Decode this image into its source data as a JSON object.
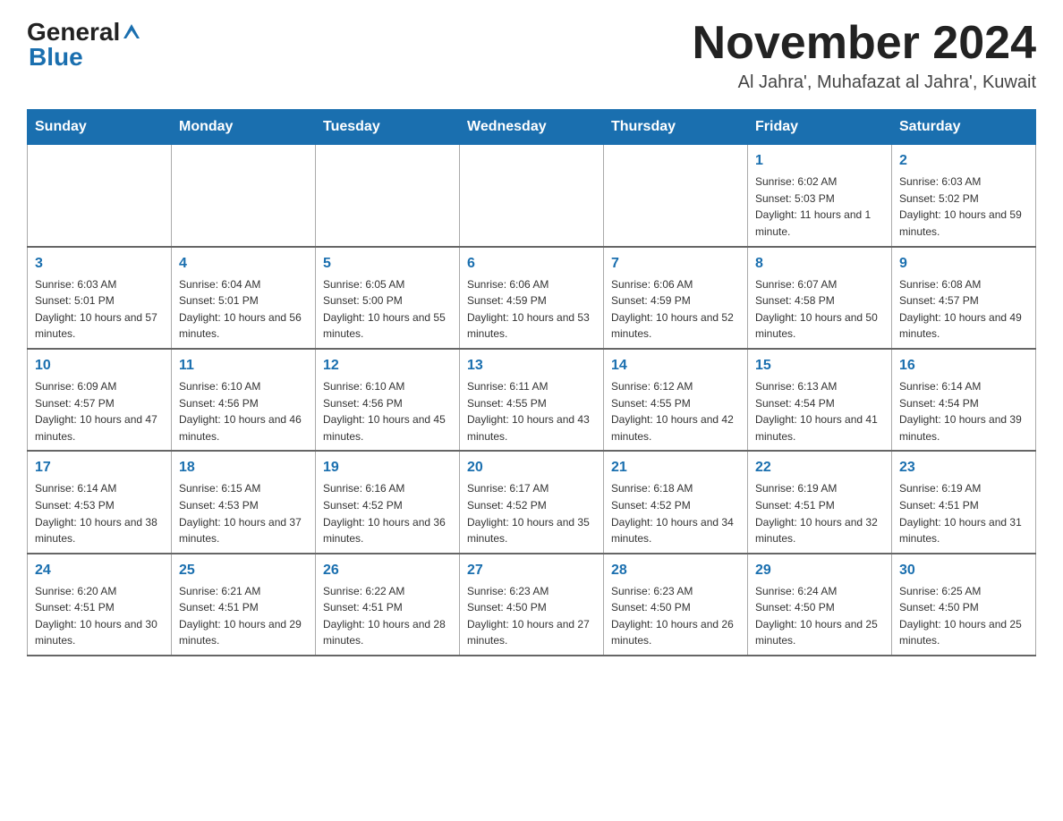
{
  "logo": {
    "general": "General",
    "blue": "Blue"
  },
  "title": "November 2024",
  "subtitle": "Al Jahra', Muhafazat al Jahra', Kuwait",
  "days_of_week": [
    "Sunday",
    "Monday",
    "Tuesday",
    "Wednesday",
    "Thursday",
    "Friday",
    "Saturday"
  ],
  "weeks": [
    [
      {
        "day": "",
        "info": ""
      },
      {
        "day": "",
        "info": ""
      },
      {
        "day": "",
        "info": ""
      },
      {
        "day": "",
        "info": ""
      },
      {
        "day": "",
        "info": ""
      },
      {
        "day": "1",
        "info": "Sunrise: 6:02 AM\nSunset: 5:03 PM\nDaylight: 11 hours and 1 minute."
      },
      {
        "day": "2",
        "info": "Sunrise: 6:03 AM\nSunset: 5:02 PM\nDaylight: 10 hours and 59 minutes."
      }
    ],
    [
      {
        "day": "3",
        "info": "Sunrise: 6:03 AM\nSunset: 5:01 PM\nDaylight: 10 hours and 57 minutes."
      },
      {
        "day": "4",
        "info": "Sunrise: 6:04 AM\nSunset: 5:01 PM\nDaylight: 10 hours and 56 minutes."
      },
      {
        "day": "5",
        "info": "Sunrise: 6:05 AM\nSunset: 5:00 PM\nDaylight: 10 hours and 55 minutes."
      },
      {
        "day": "6",
        "info": "Sunrise: 6:06 AM\nSunset: 4:59 PM\nDaylight: 10 hours and 53 minutes."
      },
      {
        "day": "7",
        "info": "Sunrise: 6:06 AM\nSunset: 4:59 PM\nDaylight: 10 hours and 52 minutes."
      },
      {
        "day": "8",
        "info": "Sunrise: 6:07 AM\nSunset: 4:58 PM\nDaylight: 10 hours and 50 minutes."
      },
      {
        "day": "9",
        "info": "Sunrise: 6:08 AM\nSunset: 4:57 PM\nDaylight: 10 hours and 49 minutes."
      }
    ],
    [
      {
        "day": "10",
        "info": "Sunrise: 6:09 AM\nSunset: 4:57 PM\nDaylight: 10 hours and 47 minutes."
      },
      {
        "day": "11",
        "info": "Sunrise: 6:10 AM\nSunset: 4:56 PM\nDaylight: 10 hours and 46 minutes."
      },
      {
        "day": "12",
        "info": "Sunrise: 6:10 AM\nSunset: 4:56 PM\nDaylight: 10 hours and 45 minutes."
      },
      {
        "day": "13",
        "info": "Sunrise: 6:11 AM\nSunset: 4:55 PM\nDaylight: 10 hours and 43 minutes."
      },
      {
        "day": "14",
        "info": "Sunrise: 6:12 AM\nSunset: 4:55 PM\nDaylight: 10 hours and 42 minutes."
      },
      {
        "day": "15",
        "info": "Sunrise: 6:13 AM\nSunset: 4:54 PM\nDaylight: 10 hours and 41 minutes."
      },
      {
        "day": "16",
        "info": "Sunrise: 6:14 AM\nSunset: 4:54 PM\nDaylight: 10 hours and 39 minutes."
      }
    ],
    [
      {
        "day": "17",
        "info": "Sunrise: 6:14 AM\nSunset: 4:53 PM\nDaylight: 10 hours and 38 minutes."
      },
      {
        "day": "18",
        "info": "Sunrise: 6:15 AM\nSunset: 4:53 PM\nDaylight: 10 hours and 37 minutes."
      },
      {
        "day": "19",
        "info": "Sunrise: 6:16 AM\nSunset: 4:52 PM\nDaylight: 10 hours and 36 minutes."
      },
      {
        "day": "20",
        "info": "Sunrise: 6:17 AM\nSunset: 4:52 PM\nDaylight: 10 hours and 35 minutes."
      },
      {
        "day": "21",
        "info": "Sunrise: 6:18 AM\nSunset: 4:52 PM\nDaylight: 10 hours and 34 minutes."
      },
      {
        "day": "22",
        "info": "Sunrise: 6:19 AM\nSunset: 4:51 PM\nDaylight: 10 hours and 32 minutes."
      },
      {
        "day": "23",
        "info": "Sunrise: 6:19 AM\nSunset: 4:51 PM\nDaylight: 10 hours and 31 minutes."
      }
    ],
    [
      {
        "day": "24",
        "info": "Sunrise: 6:20 AM\nSunset: 4:51 PM\nDaylight: 10 hours and 30 minutes."
      },
      {
        "day": "25",
        "info": "Sunrise: 6:21 AM\nSunset: 4:51 PM\nDaylight: 10 hours and 29 minutes."
      },
      {
        "day": "26",
        "info": "Sunrise: 6:22 AM\nSunset: 4:51 PM\nDaylight: 10 hours and 28 minutes."
      },
      {
        "day": "27",
        "info": "Sunrise: 6:23 AM\nSunset: 4:50 PM\nDaylight: 10 hours and 27 minutes."
      },
      {
        "day": "28",
        "info": "Sunrise: 6:23 AM\nSunset: 4:50 PM\nDaylight: 10 hours and 26 minutes."
      },
      {
        "day": "29",
        "info": "Sunrise: 6:24 AM\nSunset: 4:50 PM\nDaylight: 10 hours and 25 minutes."
      },
      {
        "day": "30",
        "info": "Sunrise: 6:25 AM\nSunset: 4:50 PM\nDaylight: 10 hours and 25 minutes."
      }
    ]
  ]
}
